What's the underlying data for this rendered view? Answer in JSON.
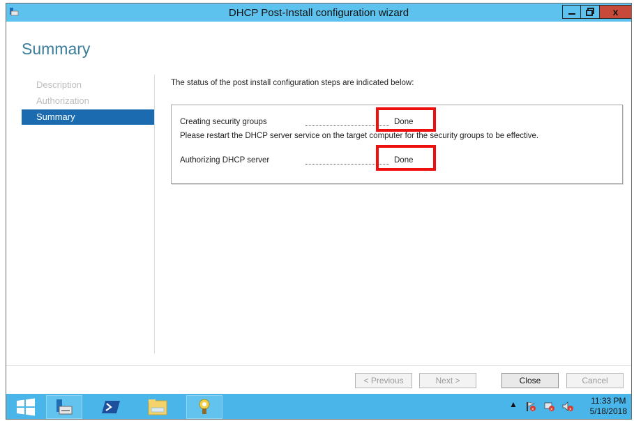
{
  "window": {
    "title": "DHCP Post-Install configuration wizard",
    "close_glyph": "x"
  },
  "page": {
    "title": "Summary"
  },
  "nav": {
    "items": [
      {
        "label": "Description",
        "active": false
      },
      {
        "label": "Authorization",
        "active": false
      },
      {
        "label": "Summary",
        "active": true
      }
    ]
  },
  "content": {
    "intro": "The status of the post install configuration steps are indicated below:",
    "steps": [
      {
        "label": "Creating security groups",
        "status": "Done"
      },
      {
        "label": "Authorizing DHCP server",
        "status": "Done"
      }
    ],
    "note": "Please restart the DHCP server service on the target computer for the security groups to be effective."
  },
  "buttons": {
    "previous": "< Previous",
    "next": "Next >",
    "close": "Close",
    "cancel": "Cancel"
  },
  "taskbar": {
    "items": [
      "windows-logo-icon",
      "dhcp-console-icon",
      "powershell-icon",
      "file-explorer-icon",
      "tool-icon"
    ],
    "tray_arrow": "▲",
    "clock_time": "11:33 PM",
    "clock_date": "5/18/2018"
  },
  "colors": {
    "titlebar": "#5ec2ee",
    "highlight": "#ee0f0f",
    "nav_active": "#1a6bb0",
    "taskbar": "#4ab5e8"
  }
}
